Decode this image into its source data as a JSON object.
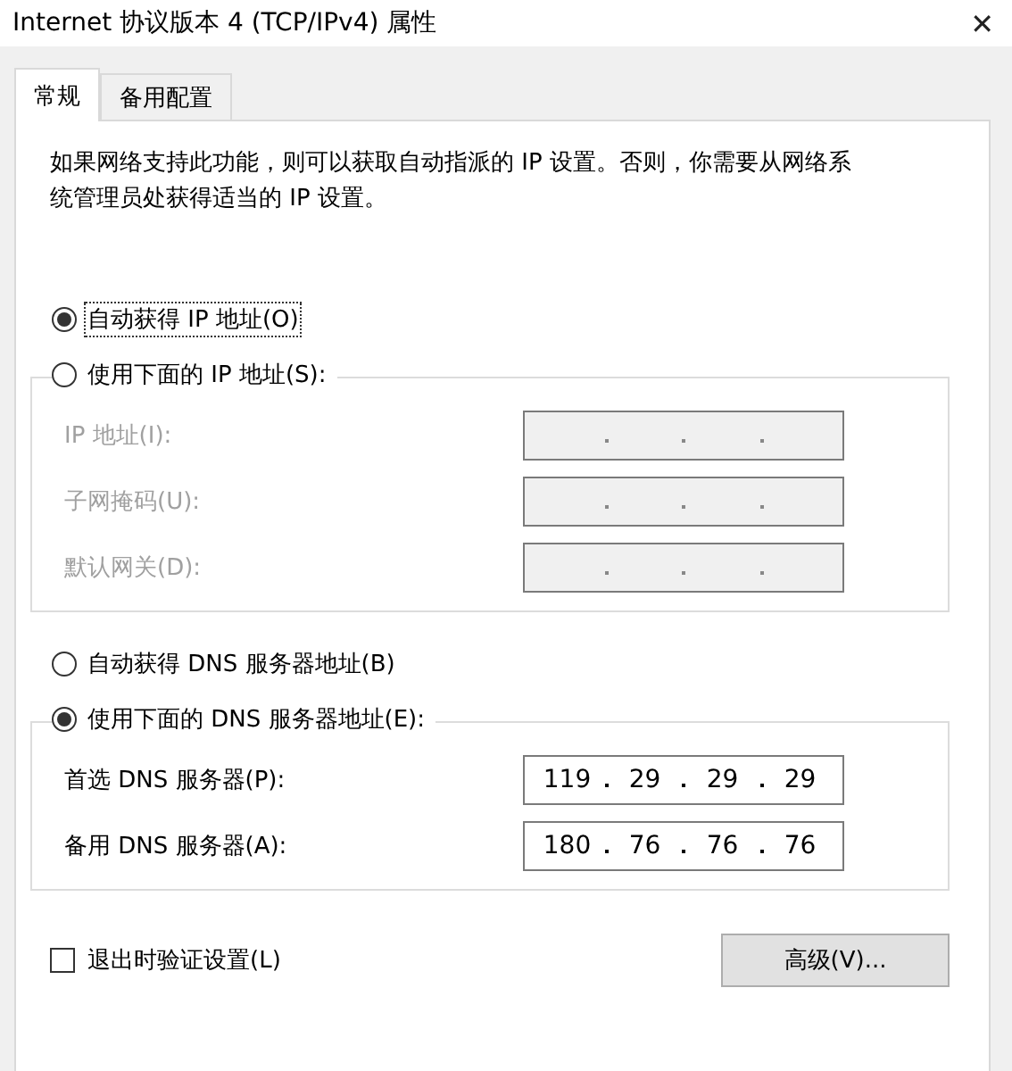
{
  "window": {
    "title": "Internet 协议版本 4 (TCP/IPv4) 属性",
    "close": "✕"
  },
  "tabs": [
    {
      "label": "常规",
      "selected": true
    },
    {
      "label": "备用配置",
      "selected": false
    }
  ],
  "description": "如果网络支持此功能，则可以获取自动指派的 IP 设置。否则，你需要从网络系统管理员处获得适当的 IP 设置。",
  "sections": [
    {
      "auto_option": {
        "label": "自动获得 IP 地址(O)",
        "selected": true,
        "focused": true
      },
      "manual_option": {
        "label": "使用下面的 IP 地址(S):",
        "selected": false
      },
      "disabled": true,
      "fields": [
        {
          "label": "IP 地址(I):"
        },
        {
          "label": "子网掩码(U):"
        },
        {
          "label": "默认网关(D):"
        }
      ]
    },
    {
      "auto_option": {
        "label": "自动获得 DNS 服务器地址(B)",
        "selected": false,
        "focused": false
      },
      "manual_option": {
        "label": "使用下面的 DNS 服务器地址(E):",
        "selected": true
      },
      "disabled": false,
      "fields": [
        {
          "label": "首选 DNS 服务器(P):",
          "octets": [
            "119",
            "29",
            "29",
            "29"
          ]
        },
        {
          "label": "备用 DNS 服务器(A):",
          "octets": [
            "180",
            "76",
            "76",
            "76"
          ]
        }
      ]
    }
  ],
  "validate_on_exit": {
    "label": "退出时验证设置(L)",
    "checked": false
  },
  "advanced_button": "高级(V)..."
}
